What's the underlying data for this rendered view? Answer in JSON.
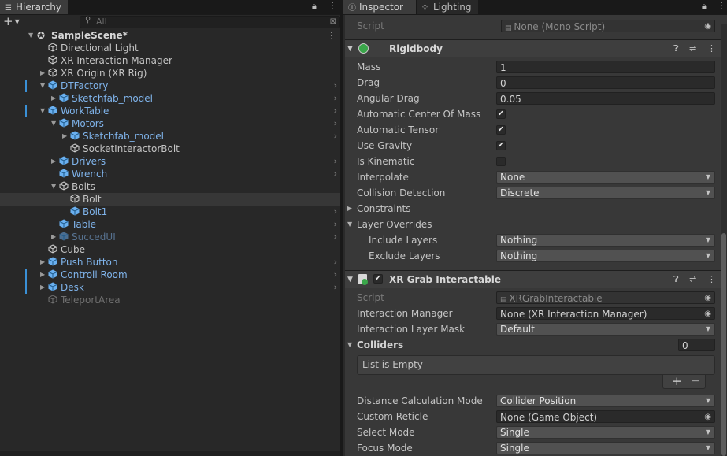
{
  "hierarchy": {
    "tab_label": "Hierarchy",
    "add_label": "+",
    "search_placeholder": "All",
    "scene": "SampleScene*",
    "rows": [
      {
        "label": "Directional Light",
        "depth": 1,
        "fold": "",
        "kind": "normal",
        "bar": false,
        "arrow": false,
        "selected": false
      },
      {
        "label": "XR Interaction Manager",
        "depth": 1,
        "fold": "",
        "kind": "normal",
        "bar": false,
        "arrow": false,
        "selected": false
      },
      {
        "label": "XR Origin (XR Rig)",
        "depth": 1,
        "fold": "closed",
        "kind": "normal",
        "bar": false,
        "arrow": false,
        "selected": false
      },
      {
        "label": "DTFactory",
        "depth": 1,
        "fold": "open",
        "kind": "prefab",
        "bar": true,
        "arrow": true,
        "selected": false
      },
      {
        "label": "Sketchfab_model",
        "depth": 2,
        "fold": "closed",
        "kind": "prefab",
        "bar": false,
        "arrow": true,
        "selected": false
      },
      {
        "label": "WorkTable",
        "depth": 1,
        "fold": "open",
        "kind": "prefab",
        "bar": true,
        "arrow": true,
        "selected": false
      },
      {
        "label": "Motors",
        "depth": 2,
        "fold": "open",
        "kind": "prefab",
        "bar": false,
        "arrow": true,
        "selected": false
      },
      {
        "label": "Sketchfab_model",
        "depth": 3,
        "fold": "closed",
        "kind": "prefab",
        "bar": false,
        "arrow": true,
        "selected": false
      },
      {
        "label": "SocketInteractorBolt",
        "depth": 3,
        "fold": "",
        "kind": "normal",
        "bar": false,
        "arrow": false,
        "selected": false
      },
      {
        "label": "Drivers",
        "depth": 2,
        "fold": "closed",
        "kind": "prefab",
        "bar": false,
        "arrow": true,
        "selected": false
      },
      {
        "label": "Wrench",
        "depth": 2,
        "fold": "",
        "kind": "prefab",
        "bar": false,
        "arrow": true,
        "selected": false
      },
      {
        "label": "Bolts",
        "depth": 2,
        "fold": "open",
        "kind": "normal",
        "bar": false,
        "arrow": false,
        "selected": false
      },
      {
        "label": "Bolt",
        "depth": 3,
        "fold": "",
        "kind": "normal",
        "bar": false,
        "arrow": false,
        "selected": true
      },
      {
        "label": "Bolt1",
        "depth": 3,
        "fold": "",
        "kind": "prefab",
        "bar": false,
        "arrow": true,
        "selected": false
      },
      {
        "label": "Table",
        "depth": 2,
        "fold": "",
        "kind": "prefab",
        "bar": false,
        "arrow": true,
        "selected": false
      },
      {
        "label": "SuccedUI",
        "depth": 2,
        "fold": "closed",
        "kind": "pdim",
        "bar": false,
        "arrow": true,
        "selected": false
      },
      {
        "label": "Cube",
        "depth": 1,
        "fold": "",
        "kind": "normal",
        "bar": false,
        "arrow": false,
        "selected": false
      },
      {
        "label": "Push Button",
        "depth": 1,
        "fold": "closed",
        "kind": "prefab",
        "bar": false,
        "arrow": true,
        "selected": false
      },
      {
        "label": "Controll Room",
        "depth": 1,
        "fold": "closed",
        "kind": "prefab",
        "bar": true,
        "arrow": true,
        "selected": false
      },
      {
        "label": "Desk",
        "depth": 1,
        "fold": "closed",
        "kind": "prefab",
        "bar": true,
        "arrow": true,
        "selected": false
      },
      {
        "label": "TeleportArea",
        "depth": 1,
        "fold": "",
        "kind": "dim",
        "bar": false,
        "arrow": false,
        "selected": false
      }
    ]
  },
  "inspector": {
    "tab_inspector": "Inspector",
    "tab_lighting": "Lighting",
    "script_label": "Script",
    "script_value": "None (Mono Script)",
    "rigidbody": {
      "title": "Rigidbody",
      "mass_label": "Mass",
      "mass": "1",
      "drag_label": "Drag",
      "drag": "0",
      "angular_drag_label": "Angular Drag",
      "angular_drag": "0.05",
      "auto_com_label": "Automatic Center Of Mass",
      "auto_com": true,
      "auto_tensor_label": "Automatic Tensor",
      "auto_tensor": true,
      "use_gravity_label": "Use Gravity",
      "use_gravity": true,
      "is_kinematic_label": "Is Kinematic",
      "is_kinematic": false,
      "interpolate_label": "Interpolate",
      "interpolate": "None",
      "collision_label": "Collision Detection",
      "collision": "Discrete",
      "constraints_label": "Constraints",
      "layer_overrides_label": "Layer Overrides",
      "include_label": "Include Layers",
      "include": "Nothing",
      "exclude_label": "Exclude Layers",
      "exclude": "Nothing"
    },
    "grab": {
      "title": "XR Grab Interactable",
      "enabled": true,
      "script_label": "Script",
      "script_value": "XRGrabInteractable",
      "manager_label": "Interaction Manager",
      "manager": "None (XR Interaction Manager)",
      "layer_mask_label": "Interaction Layer Mask",
      "layer_mask": "Default",
      "colliders_label": "Colliders",
      "colliders_count": "0",
      "list_empty": "List is Empty",
      "plus": "+",
      "minus": "−",
      "distance_label": "Distance Calculation Mode",
      "distance": "Collider Position",
      "reticle_label": "Custom Reticle",
      "reticle": "None (Game Object)",
      "select_label": "Select Mode",
      "select": "Single",
      "focus_label": "Focus Mode",
      "focus": "Single"
    }
  }
}
